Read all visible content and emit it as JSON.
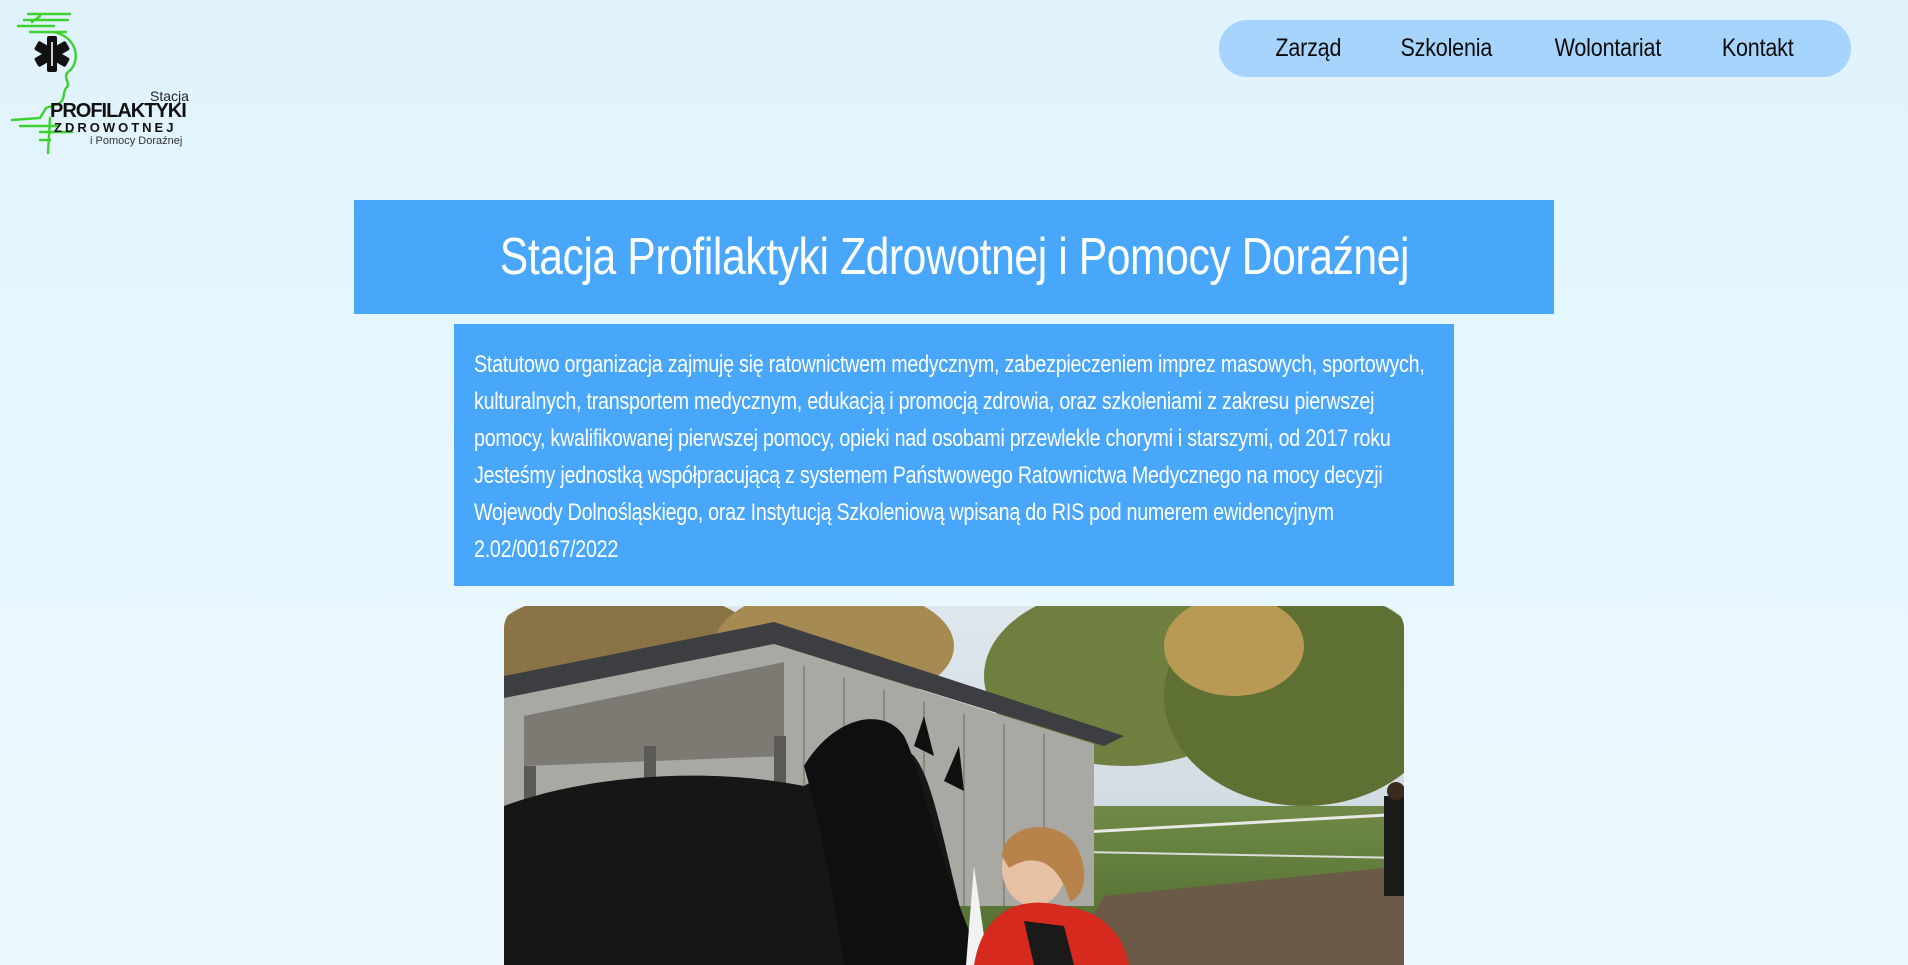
{
  "logo": {
    "line1": "Stacja",
    "line2": "PROFILAKTYKI",
    "line3": "ZDROWOTNEJ",
    "line4": "i Pomocy Doraźnej",
    "icon": "star-of-life-icon"
  },
  "nav": {
    "items": [
      {
        "label": "Zarząd"
      },
      {
        "label": "Szkolenia"
      },
      {
        "label": "Wolontariat"
      },
      {
        "label": "Kontakt"
      }
    ]
  },
  "hero": {
    "title": "Stacja Profilaktyki Zdrowotnej i Pomocy Doraźnej"
  },
  "about": {
    "text": "Statutowo organizacja zajmuję się ratownictwem medycznym, zabezpieczeniem imprez masowych, sportowych, kulturalnych, transportem medycznym, edukacją i promocją zdrowia, oraz szkoleniami z zakresu pierwszej pomocy, kwalifikowanej pierwszej pomocy, opieki nad osobami przewlekle chorymi i starszymi, od 2017 roku Jesteśmy jednostką współpracującą z systemem Państwowego Ratownictwa Medycznego na mocy decyzji Wojewody Dolnośląskiego, oraz Instytucją Szkoleniową wpisaną do RIS pod numerem ewidencyjnym 2.02/00167/2022"
  },
  "colors": {
    "background": "#e3f5fd",
    "nav_pill": "#a6d4fc",
    "accent_box": "#48a7fb",
    "logo_green": "#3dd12f"
  }
}
